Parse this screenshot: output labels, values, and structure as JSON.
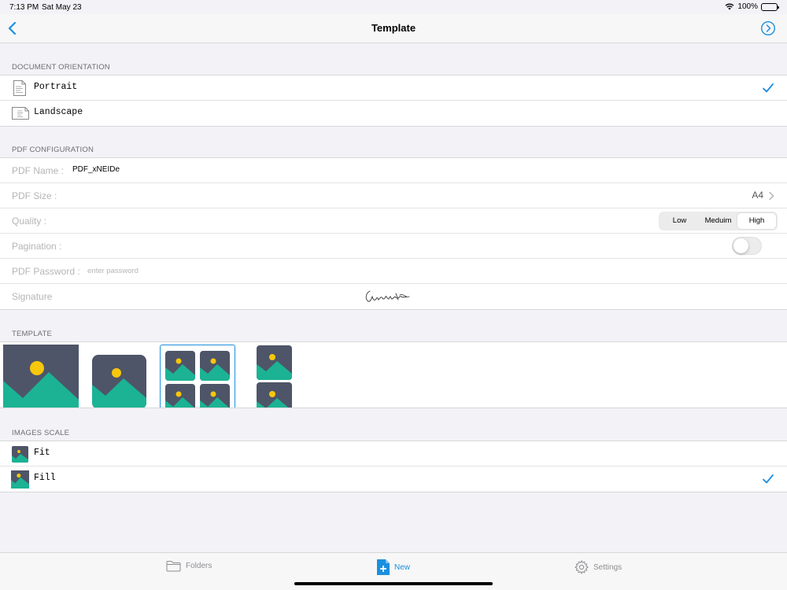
{
  "status": {
    "time": "7:13 PM",
    "date": "Sat May 23",
    "battery": "100%"
  },
  "nav": {
    "title": "Template"
  },
  "orientation": {
    "header": "DOCUMENT ORIENTATION",
    "options": [
      {
        "label": "Portrait",
        "selected": true,
        "icon": "portrait-doc-icon"
      },
      {
        "label": "Landscape",
        "selected": false,
        "icon": "landscape-doc-icon"
      }
    ]
  },
  "pdf_config": {
    "header": "PDF CONFIGURATION",
    "name_label": "PDF Name :",
    "name_value": "PDF_xNEIDe",
    "size_label": "PDF Size :",
    "size_value": "A4",
    "quality_label": "Quality :",
    "quality_options": [
      "Low",
      "Meduim",
      "High"
    ],
    "quality_selected": "High",
    "pagination_label": "Pagination :",
    "pagination_on": false,
    "password_label": "PDF Password :",
    "password_placeholder": "enter password",
    "signature_label": "Signature"
  },
  "template": {
    "header": "TEMPLATE",
    "selected_index": 2
  },
  "images_scale": {
    "header": "IMAGES SCALE",
    "options": [
      {
        "label": "Fit",
        "selected": false
      },
      {
        "label": "Fill",
        "selected": true
      }
    ]
  },
  "tabs": [
    {
      "label": "Folders",
      "icon": "folder-icon",
      "active": false
    },
    {
      "label": "New",
      "icon": "new-document-icon",
      "active": true
    },
    {
      "label": "Settings",
      "icon": "gear-icon",
      "active": false
    }
  ],
  "colors": {
    "accent": "#1a8fe0",
    "image_bg": "#4e5568",
    "image_mountain": "#1bb394",
    "image_sun": "#f7c70b"
  }
}
